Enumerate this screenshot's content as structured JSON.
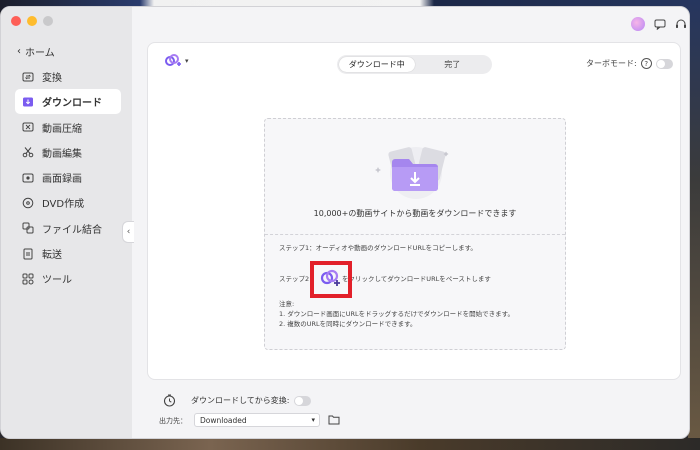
{
  "sidebar": {
    "home_label": "ホーム",
    "items": [
      {
        "label": "変換",
        "icon": "convert-icon"
      },
      {
        "label": "ダウンロード",
        "icon": "download-icon",
        "active": true
      },
      {
        "label": "動画圧縮",
        "icon": "compress-icon"
      },
      {
        "label": "動画編集",
        "icon": "scissors-icon"
      },
      {
        "label": "画面録画",
        "icon": "record-icon"
      },
      {
        "label": "DVD作成",
        "icon": "dvd-icon"
      },
      {
        "label": "ファイル結合",
        "icon": "merge-icon"
      },
      {
        "label": "転送",
        "icon": "transfer-icon"
      },
      {
        "label": "ツール",
        "icon": "tools-icon"
      }
    ]
  },
  "header": {
    "tabs": [
      {
        "label": "ダウンロード中",
        "active": true
      },
      {
        "label": "完了",
        "active": false
      }
    ],
    "turbo_label": "ターボモード:",
    "help_glyph": "?"
  },
  "dropzone": {
    "headline": "10,000+の動画サイトから動画をダウンロードできます",
    "step1": "ステップ1：オーディオや動画のダウンロードURLをコピーします。",
    "step2_label": "ステップ2：",
    "step2_text": "をクリックしてダウンロードURLをペーストします",
    "note_title": "注意:",
    "note_1": "1. ダウンロード画面にURLをドラッグするだけでダウンロードを開始できます。",
    "note_2": "2. 複数のURLを同時にダウンロードできます。"
  },
  "bottom": {
    "convert_label": "ダウンロードしてから変換:",
    "output_label": "出力先：",
    "output_value": "Downloaded"
  },
  "colors": {
    "accent_purple": "#7b5cf0",
    "highlight_red": "#e2202a"
  }
}
